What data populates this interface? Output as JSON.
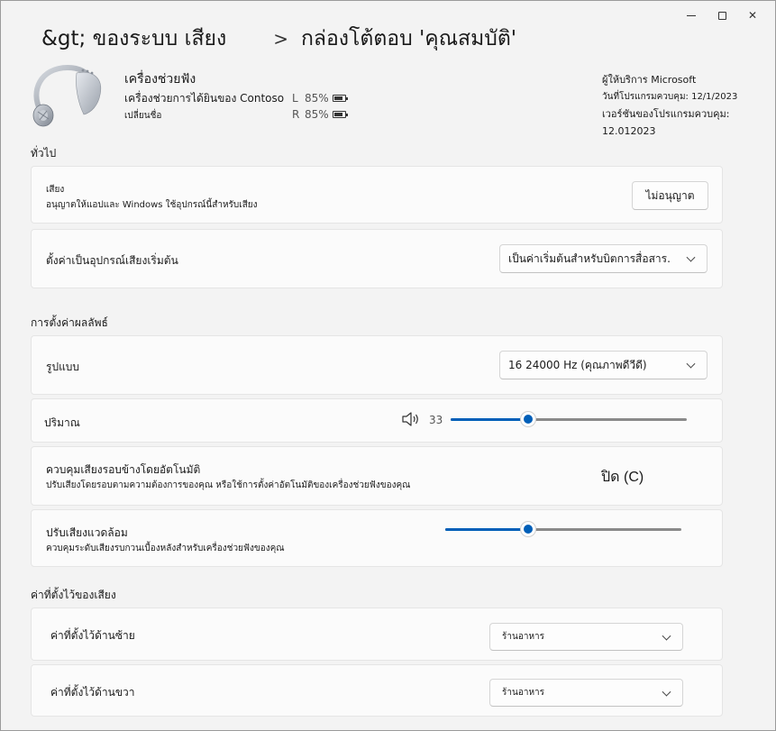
{
  "window": {
    "controls": {
      "minimize": "minimize-icon",
      "maximize": "maximize-icon",
      "close": "close-icon"
    }
  },
  "breadcrumb": {
    "parent": "&gt; ของระบบ  เสียง",
    "separator": ">",
    "current": "กล่องโต้ตอบ 'คุณสมบัติ'"
  },
  "device": {
    "name": "เครื่องช่วยฟัง",
    "subtitle": "เครื่องช่วยการได้ยินของ Contoso",
    "rename": "เปลี่ยนชื่อ",
    "battery_left": {
      "side": "L",
      "percent": "85%",
      "level": 0.85
    },
    "battery_right": {
      "side": "R",
      "percent": "85%",
      "level": 0.85
    }
  },
  "vendor": {
    "provider": "ผู้ให้บริการ Microsoft",
    "program_date": "วันที่โปรแกรมควบคุม: 12/1/2023",
    "program_version": "เวอร์ชันของโปรแกรมควบคุม: 12.012023"
  },
  "general": {
    "title": "ทั่วไป",
    "audio": {
      "title": "เสียง",
      "desc": "อนุญาตให้แอปและ Windows ใช้อุปกรณ์นี้สำหรับเสียง",
      "button": "ไม่อนุญาต"
    },
    "default_device": {
      "title": "ตั้งค่าเป็นอุปกรณ์เสียงเริ่มต้น",
      "value": "เป็นค่าเริ่มต้นสำหรับบิตการสื่อสาร."
    }
  },
  "output": {
    "title": "การตั้งค่าผลลัพธ์",
    "format": {
      "title": "รูปแบบ",
      "value": "16 24000 Hz (คุณภาพดีวีดี)"
    },
    "volume": {
      "title": "ปริมาณ",
      "value": "33",
      "level": 0.33,
      "icon": "speaker-icon"
    },
    "ambient_control": {
      "title": "ควบคุมเสียงรอบข้างโดยอัตโนมัติ",
      "desc": "ปรับเสียงโดยรอบตามความต้องการของคุณ หรือใช้การตั้งค่าอัตโนมัติของเครื่องช่วยฟังของคุณ",
      "state": "ปิด (C)"
    },
    "ambient_adjust": {
      "title": "ปรับเสียงแวดล้อม",
      "desc": "ควบคุมระดับเสียงรบกวนเบื้องหลังสำหรับเครื่องช่วยฟังของคุณ",
      "level": 0.35
    }
  },
  "presets": {
    "title": "ค่าที่ตั้งไว้ของเสียง",
    "left": {
      "title": "ค่าที่ตั้งไว้ด้านซ้าย",
      "value": "ร้านอาหาร"
    },
    "right": {
      "title": "ค่าที่ตั้งไว้ด้านขวา",
      "value": "ร้านอาหาร"
    }
  },
  "colors": {
    "accent": "#005fb8",
    "background": "#f3f3f3",
    "card": "#fbfbfb"
  }
}
